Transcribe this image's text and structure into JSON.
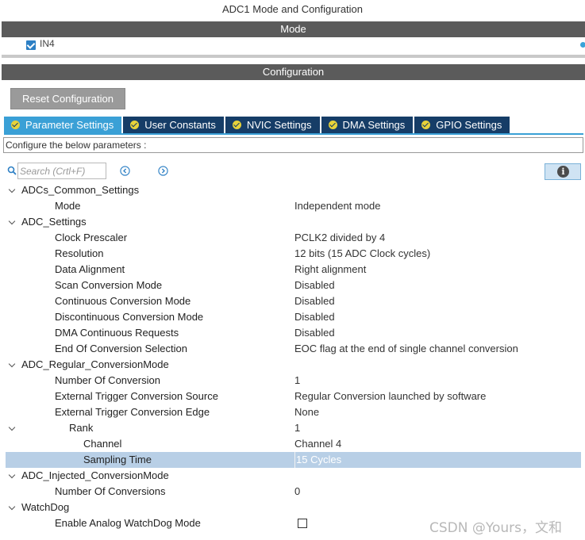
{
  "window": {
    "title": "ADC1 Mode and Configuration"
  },
  "mode": {
    "header": "Mode",
    "channel_label": "IN4",
    "channel_checked": true
  },
  "configuration": {
    "header": "Configuration",
    "reset_label": "Reset Configuration",
    "tabs": [
      {
        "label": "Parameter Settings",
        "active": true
      },
      {
        "label": "User Constants",
        "active": false
      },
      {
        "label": "NVIC Settings",
        "active": false
      },
      {
        "label": "DMA Settings",
        "active": false
      },
      {
        "label": "GPIO Settings",
        "active": false
      }
    ],
    "description": "Configure the below parameters :",
    "search": {
      "placeholder": "Search (Crtl+F)",
      "value": ""
    },
    "icons": {
      "search": "search-icon",
      "prev": "arrow-left-circle-icon",
      "next": "arrow-right-circle-icon",
      "info": "info-icon",
      "tab_status": "check-circle-icon"
    },
    "colors": {
      "tab_active": "#3aa0d6",
      "tab_inactive": "#163d67",
      "tab_check": "#e7d23a",
      "header_bar": "#5b5b5b",
      "selected_row": "#b8cfe6"
    }
  },
  "tree": {
    "groups": [
      {
        "name": "ADCs_Common_Settings",
        "params": [
          {
            "label": "Mode",
            "value": "Independent mode"
          }
        ]
      },
      {
        "name": "ADC_Settings",
        "params": [
          {
            "label": "Clock Prescaler",
            "value": "PCLK2 divided by 4"
          },
          {
            "label": "Resolution",
            "value": "12 bits (15 ADC Clock cycles)"
          },
          {
            "label": "Data Alignment",
            "value": "Right alignment"
          },
          {
            "label": "Scan Conversion Mode",
            "value": "Disabled"
          },
          {
            "label": "Continuous Conversion Mode",
            "value": "Disabled"
          },
          {
            "label": "Discontinuous Conversion Mode",
            "value": "Disabled"
          },
          {
            "label": "DMA Continuous Requests",
            "value": "Disabled"
          },
          {
            "label": "End Of Conversion Selection",
            "value": "EOC flag at the end of single channel conversion"
          }
        ]
      },
      {
        "name": "ADC_Regular_ConversionMode",
        "params": [
          {
            "label": "Number Of Conversion",
            "value": "1"
          },
          {
            "label": "External Trigger Conversion Source",
            "value": "Regular Conversion launched by software"
          },
          {
            "label": "External Trigger Conversion Edge",
            "value": "None"
          }
        ],
        "rank": {
          "label": "Rank",
          "value": "1",
          "params": [
            {
              "label": "Channel",
              "value": "Channel 4"
            },
            {
              "label": "Sampling Time",
              "value": "15 Cycles",
              "selected": true
            }
          ]
        }
      },
      {
        "name": "ADC_Injected_ConversionMode",
        "params": [
          {
            "label": "Number Of Conversions",
            "value": "0"
          }
        ]
      },
      {
        "name": "WatchDog",
        "params": [
          {
            "label": "Enable Analog WatchDog Mode",
            "checked": false
          }
        ]
      }
    ]
  },
  "watermark": "CSDN @Yours，文和"
}
